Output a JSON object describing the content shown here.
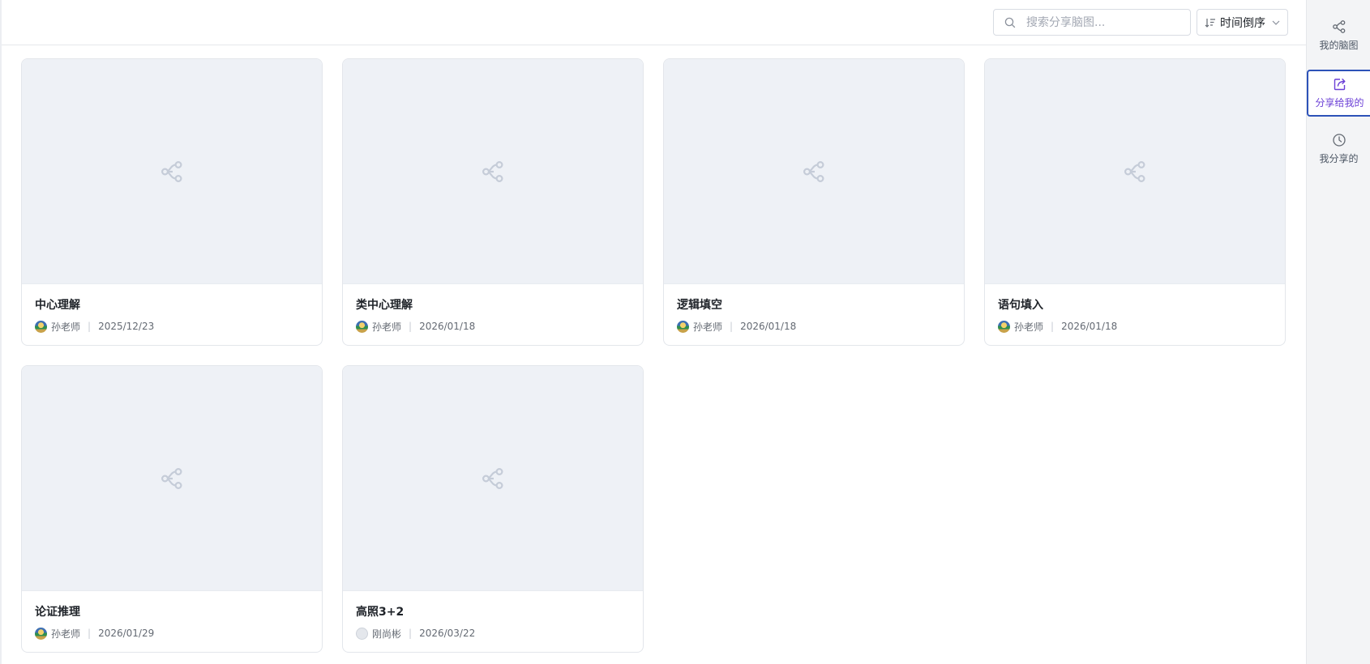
{
  "search": {
    "placeholder": "搜索分享脑图..."
  },
  "sort": {
    "label": "时间倒序"
  },
  "cards": [
    {
      "title": "中心理解",
      "author": "孙老师",
      "date": "2025/12/23",
      "avatar": "photo"
    },
    {
      "title": "类中心理解",
      "author": "孙老师",
      "date": "2026/01/18",
      "avatar": "photo"
    },
    {
      "title": "逻辑填空",
      "author": "孙老师",
      "date": "2026/01/18",
      "avatar": "photo"
    },
    {
      "title": "语句填入",
      "author": "孙老师",
      "date": "2026/01/18",
      "avatar": "photo"
    },
    {
      "title": "论证推理",
      "author": "孙老师",
      "date": "2026/01/29",
      "avatar": "photo"
    },
    {
      "title": "高照3+2",
      "author": "刚尚彬",
      "date": "2026/03/22",
      "avatar": "default"
    }
  ],
  "sidebar": {
    "items": [
      {
        "label": "我的脑图",
        "icon": "share-nodes-icon",
        "active": false
      },
      {
        "label": "分享给我的",
        "icon": "share-out-icon",
        "active": true
      },
      {
        "label": "我分享的",
        "icon": "clock-icon",
        "active": false
      }
    ]
  },
  "colors": {
    "accent": "#6b3fd6",
    "active_border": "#2d52b8",
    "thumb_bg": "#eef1f6"
  }
}
